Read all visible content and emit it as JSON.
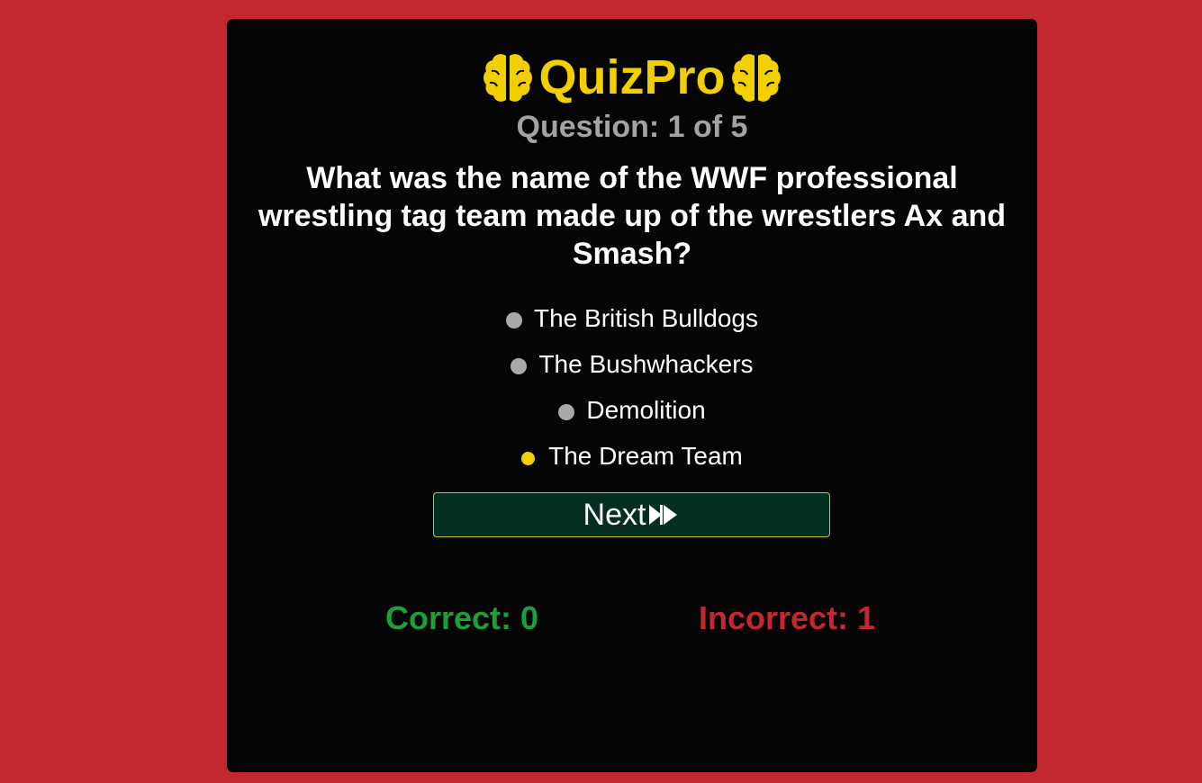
{
  "app": {
    "title": "QuizPro",
    "brand_color": "#f2d000",
    "background_color": "#c32830",
    "card_color": "#050505",
    "logo_icon": "brain-icon"
  },
  "quiz": {
    "counter": "Question: 1 of 5",
    "question": "What was the name of the WWF professional wrestling tag team made up of the wrestlers Ax and Smash?",
    "answers": [
      {
        "label": "The British Bulldogs",
        "selected": false
      },
      {
        "label": "The Bushwhackers",
        "selected": false
      },
      {
        "label": "Demolition",
        "selected": false
      },
      {
        "label": "The Dream Team",
        "selected": true
      }
    ],
    "next_label": "Next",
    "next_icon": "fast-forward-icon"
  },
  "score": {
    "correct": "Correct: 0",
    "incorrect": "Incorrect: 1",
    "correct_color": "#1e9e3a",
    "incorrect_color": "#c32830"
  }
}
